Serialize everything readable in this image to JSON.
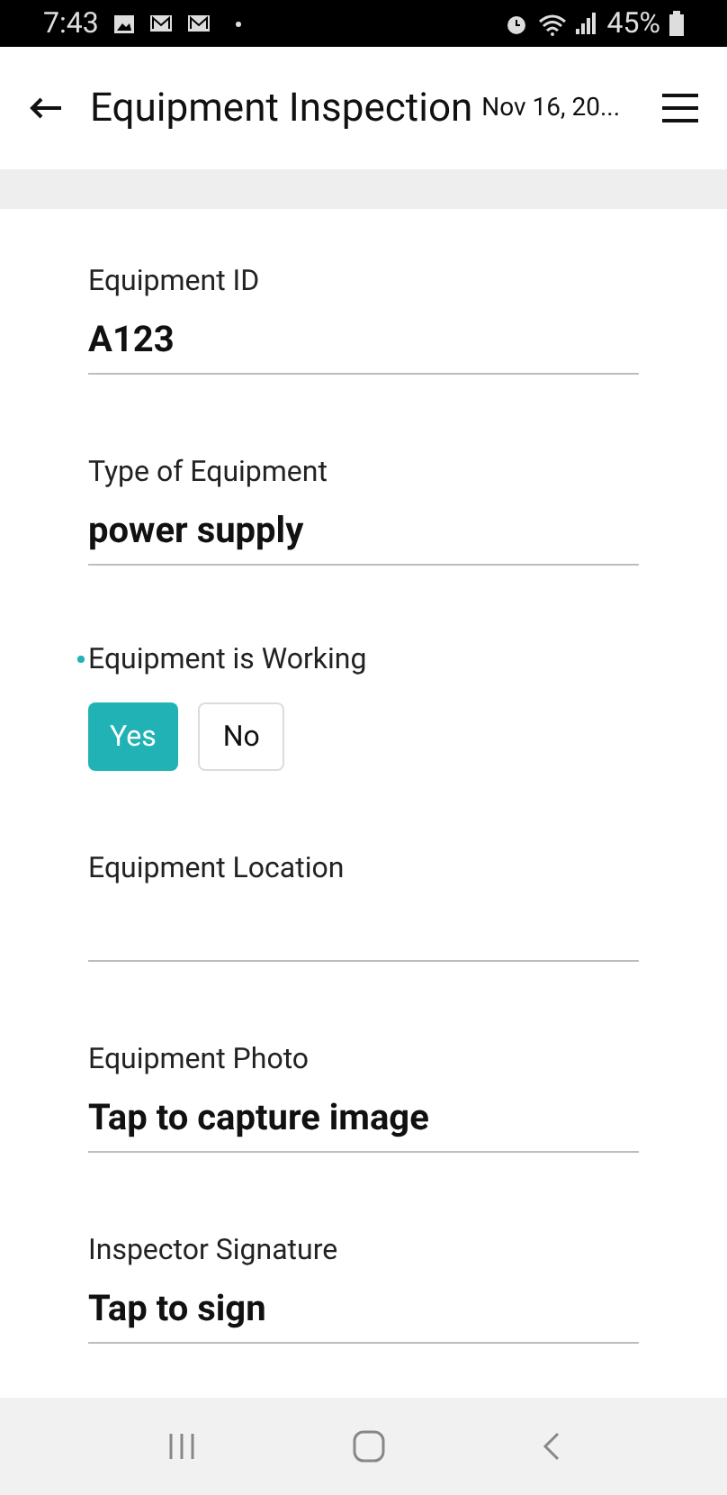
{
  "status_bar": {
    "time": "7:43",
    "battery": "45%"
  },
  "header": {
    "title": "Equipment Inspection",
    "subtitle": "Nov 16, 20..."
  },
  "fields": [
    {
      "kind": "text",
      "label": "Equipment ID",
      "value": "A123",
      "required": false
    },
    {
      "kind": "text",
      "label": "Type of Equipment",
      "value": "power supply",
      "required": false
    },
    {
      "kind": "choice",
      "label": "Equipment is Working",
      "required": true,
      "options": [
        {
          "label": "Yes",
          "selected": true
        },
        {
          "label": "No",
          "selected": false
        }
      ]
    },
    {
      "kind": "text",
      "label": "Equipment Location",
      "required": false
    },
    {
      "kind": "text",
      "label": "Equipment Photo",
      "value": "Tap to capture image",
      "required": false
    },
    {
      "kind": "text",
      "label": "Inspector Signature",
      "value": "Tap to sign",
      "required": false
    }
  ]
}
